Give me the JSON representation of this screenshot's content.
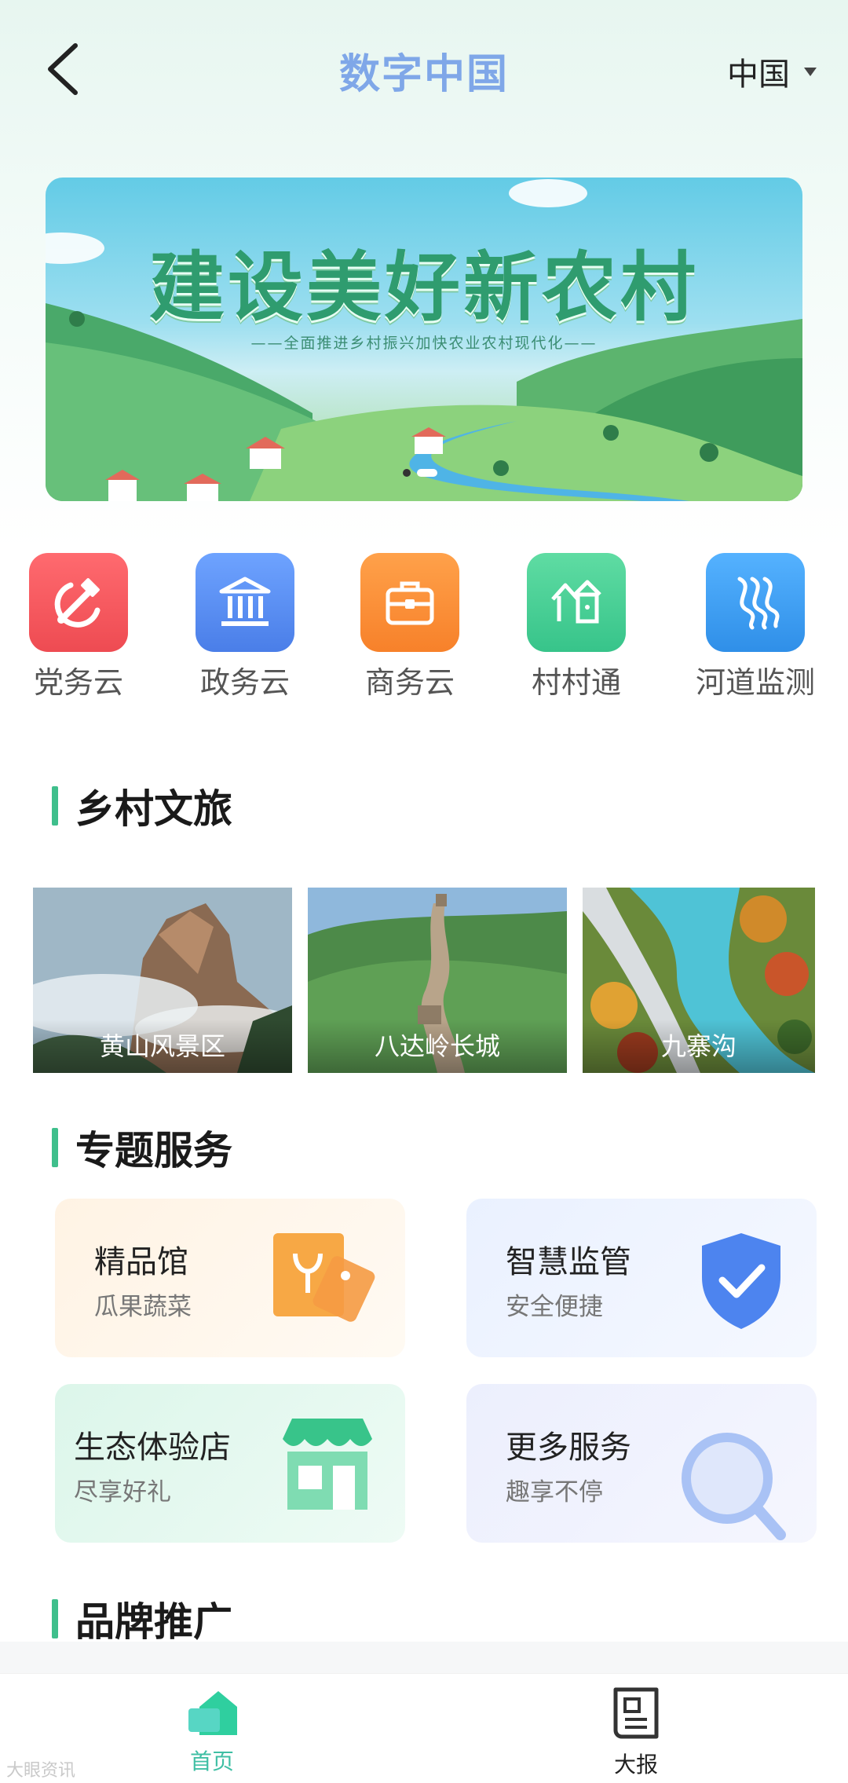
{
  "header": {
    "title": "数字中国",
    "region": "中国",
    "back_icon": "chevron-left-icon"
  },
  "banner": {
    "title": "建设美好新农村",
    "subtitle": "——全面推进乡村振兴加快农业农村现代化——",
    "slide_count": 2,
    "active_slide": 2
  },
  "quick_links": [
    {
      "label": "党务云",
      "icon": "party-emblem-icon",
      "color": "#f0515a"
    },
    {
      "label": "政务云",
      "icon": "government-building-icon",
      "color": "#5b8ef0"
    },
    {
      "label": "商务云",
      "icon": "briefcase-icon",
      "color": "#f98b2f"
    },
    {
      "label": "村村通",
      "icon": "village-house-icon",
      "color": "#3fc98f"
    },
    {
      "label": "河道监测",
      "icon": "river-icon",
      "color": "#3a9bf0"
    }
  ],
  "sections": {
    "tourism": "乡村文旅",
    "services": "专题服务",
    "brand": "品牌推广"
  },
  "scenic_spots": [
    {
      "name": "黄山风景区"
    },
    {
      "name": "八达岭长城"
    },
    {
      "name": "九寨沟"
    }
  ],
  "services": [
    {
      "title": "精品馆",
      "subtitle": "瓜果蔬菜",
      "icon": "price-tag-icon"
    },
    {
      "title": "智慧监管",
      "subtitle": "安全便捷",
      "icon": "shield-check-icon"
    },
    {
      "title": "生态体验店",
      "subtitle": "尽享好礼",
      "icon": "store-icon"
    },
    {
      "title": "更多服务",
      "subtitle": "趣享不停",
      "icon": "magnifier-icon"
    }
  ],
  "bottom_nav": [
    {
      "label": "首页",
      "icon": "home-icon",
      "active": true
    },
    {
      "label": "大报",
      "icon": "newspaper-icon",
      "active": false
    }
  ],
  "watermark": "大眼资讯",
  "colors": {
    "accent_green": "#3fbf8c",
    "title_blue": "#7fa7e8",
    "nav_active": "#3fbfa4"
  }
}
